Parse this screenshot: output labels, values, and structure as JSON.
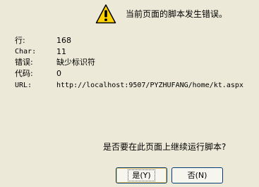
{
  "dialog": {
    "heading": "当前页面的脚本发生错误。",
    "question": "是否要在此页面上继续运行脚本?",
    "colors": {
      "background": "#ece9d8",
      "icon_fill": "#ffd200",
      "button_border": "#003c74"
    }
  },
  "details": {
    "line_label": "行:",
    "line_value": "168",
    "char_label": "Char:",
    "char_value": "11",
    "error_label": "错误:",
    "error_value": "缺少标识符",
    "code_label": "代码:",
    "code_value": "0",
    "url_label": "URL:",
    "url_value": "http://localhost:9507/PYZHUFANG/home/kt.aspx"
  },
  "buttons": {
    "yes_label": "是(Y)",
    "no_label": "否(N)"
  },
  "icons": {
    "warning": "warning-icon"
  }
}
